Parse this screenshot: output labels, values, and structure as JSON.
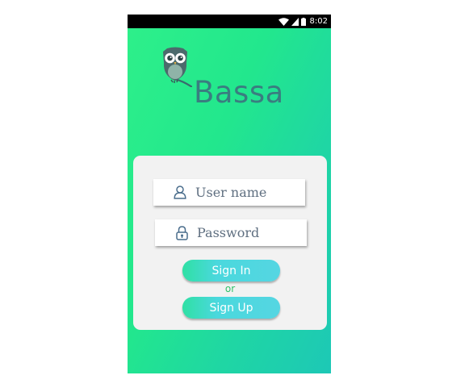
{
  "status_bar": {
    "time": "8:02",
    "icons": [
      "wifi-icon",
      "signal-icon",
      "battery-icon"
    ]
  },
  "brand": {
    "name": "Bassa",
    "logo_icon": "owl-icon"
  },
  "login": {
    "username_placeholder": "User name",
    "username_icon": "user-icon",
    "password_placeholder": "Password",
    "password_icon": "lock-icon",
    "sign_in_label": "Sign In",
    "or_label": "or",
    "sign_up_label": "Sign Up"
  },
  "colors": {
    "gradient_start": "#2ef08a",
    "gradient_end": "#1dc8b6",
    "brand_text": "#3a7d80",
    "button": "#4ad8dd",
    "or_text": "#2fc268",
    "card_bg": "#f2f2f2"
  }
}
